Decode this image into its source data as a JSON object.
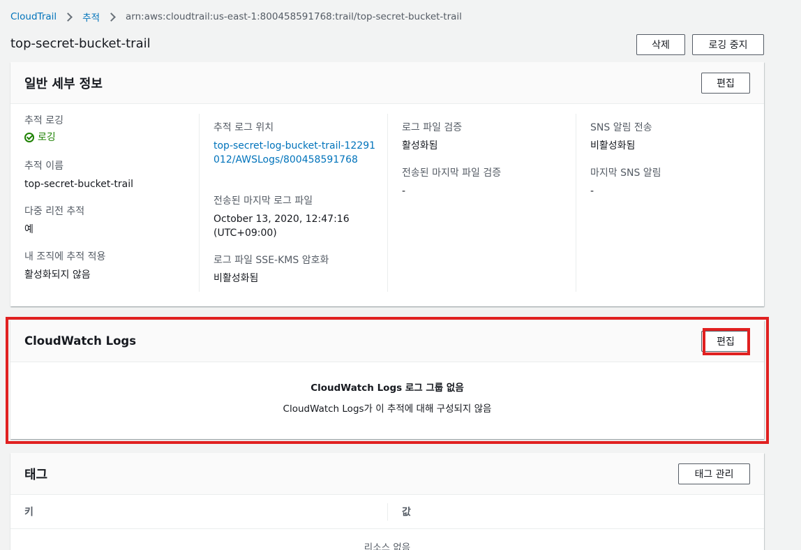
{
  "breadcrumb": {
    "root": "CloudTrail",
    "section": "추적",
    "current": "arn:aws:cloudtrail:us-east-1:800458591768:trail/top-secret-bucket-trail"
  },
  "page": {
    "title": "top-secret-bucket-trail",
    "delete_label": "삭제",
    "stop_logging_label": "로깅 중지"
  },
  "general": {
    "title": "일반 세부 정보",
    "edit_label": "편집",
    "trail_logging_label": "추적 로깅",
    "trail_logging_value": "로깅",
    "trail_name_label": "추적 이름",
    "trail_name_value": "top-secret-bucket-trail",
    "multi_region_label": "다중 리전 추적",
    "multi_region_value": "예",
    "org_trail_label": "내 조직에 추적 적용",
    "org_trail_value": "활성화되지 않음",
    "log_location_label": "추적 로그 위치",
    "log_location_value": "top-secret-log-bucket-trail-12291012/AWSLogs/800458591768",
    "last_log_file_label": "전송된 마지막 로그 파일",
    "last_log_file_value": "October 13, 2020, 12:47:16 (UTC+09:00)",
    "sse_kms_label": "로그 파일 SSE-KMS 암호화",
    "sse_kms_value": "비활성화됨",
    "validation_label": "로그 파일 검증",
    "validation_value": "활성화됨",
    "last_validation_label": "전송된 마지막 파일 검증",
    "last_validation_value": "-",
    "sns_label": "SNS 알림 전송",
    "sns_value": "비활성화됨",
    "last_sns_label": "마지막 SNS 알림",
    "last_sns_value": "-"
  },
  "cloudwatch": {
    "title": "CloudWatch Logs",
    "edit_label": "편집",
    "empty_title": "CloudWatch Logs 로그 그룹 없음",
    "empty_desc": "CloudWatch Logs가 이 추적에 대해 구성되지 않음"
  },
  "tags": {
    "title": "태그",
    "manage_label": "태그 관리",
    "col_key": "키",
    "col_value": "값",
    "empty": "리소스 없음"
  },
  "colors": {
    "link": "#0073bb",
    "success": "#1d8102",
    "highlight": "#e02020"
  }
}
